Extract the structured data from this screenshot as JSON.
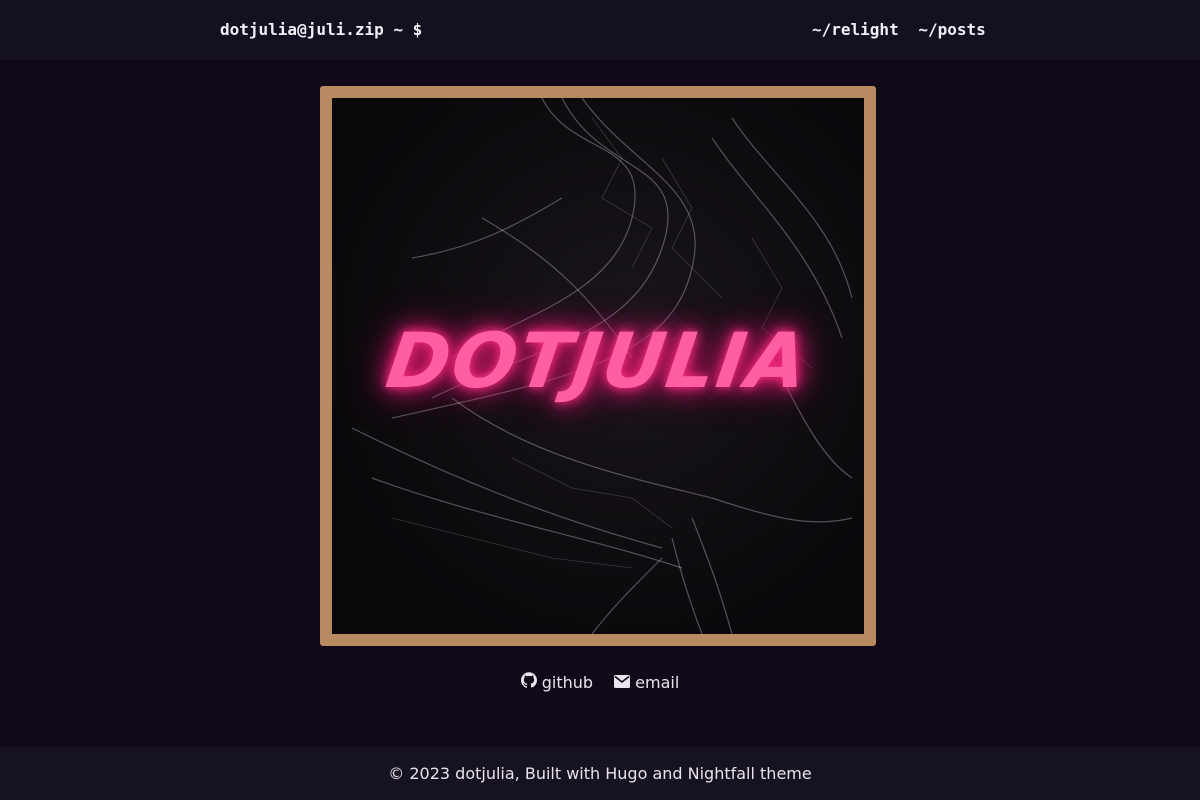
{
  "header": {
    "brand": "dotjulia@juli.zip ~ $",
    "nav": [
      {
        "label": "~/relight"
      },
      {
        "label": "~/posts"
      }
    ]
  },
  "cover": {
    "logo_text": "DOTJULIA",
    "colors": {
      "frame": "#b88a62",
      "neon": "#ff5fa2"
    }
  },
  "social": {
    "links": [
      {
        "icon": "github-icon",
        "label": "github"
      },
      {
        "icon": "envelope-icon",
        "label": "email"
      }
    ]
  },
  "footer": {
    "text": "© 2023 dotjulia, Built with Hugo and Nightfall theme"
  },
  "colors": {
    "background": "#100a18",
    "header_bg": "#15101f",
    "footer_bg": "#17121f",
    "text": "#e8e4ee"
  }
}
